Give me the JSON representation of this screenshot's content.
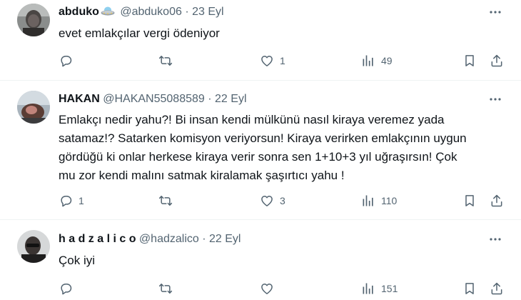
{
  "tweets": [
    {
      "name": "abduko",
      "badge_icon": "flying-saucer-emoji",
      "handle": "@abduko06",
      "separator": "·",
      "date": "23 Eyl",
      "text": "evet emlakçılar vergi ödeniyor",
      "reply_count": "",
      "retweet_count": "",
      "like_count": "1",
      "view_count": "49"
    },
    {
      "name": "HAKAN",
      "handle": "@HAKAN55088589",
      "separator": "·",
      "date": "22 Eyl",
      "text": "Emlakçı nedir  yahu?! Bi insan kendi mülkünü nasıl kiraya veremez yada\nsatamaz!? Satarken komisyon veriyorsun! Kiraya verirken emlakçının uygun\ngördüğü ki onlar herkese kiraya verir sonra sen 1+10+3 yıl uğraşırsın! Çok\nmu zor kendi malını satmak kiralamak şaşırtıcı yahu !",
      "reply_count": "1",
      "retweet_count": "",
      "like_count": "3",
      "view_count": "110"
    },
    {
      "name": "h a d z a l i c o",
      "handle": "@hadzalico",
      "separator": "·",
      "date": "22 Eyl",
      "text": "Çok iyi",
      "reply_count": "",
      "retweet_count": "",
      "like_count": "",
      "view_count": "151"
    }
  ],
  "icons": {
    "reply": "reply-icon",
    "retweet": "retweet-icon",
    "like": "heart-icon",
    "views": "views-icon",
    "bookmark": "bookmark-icon",
    "share": "share-icon",
    "more": "more-icon"
  },
  "colors": {
    "text": "#0f1419",
    "secondary": "#536471",
    "divider": "#eff3f4"
  }
}
